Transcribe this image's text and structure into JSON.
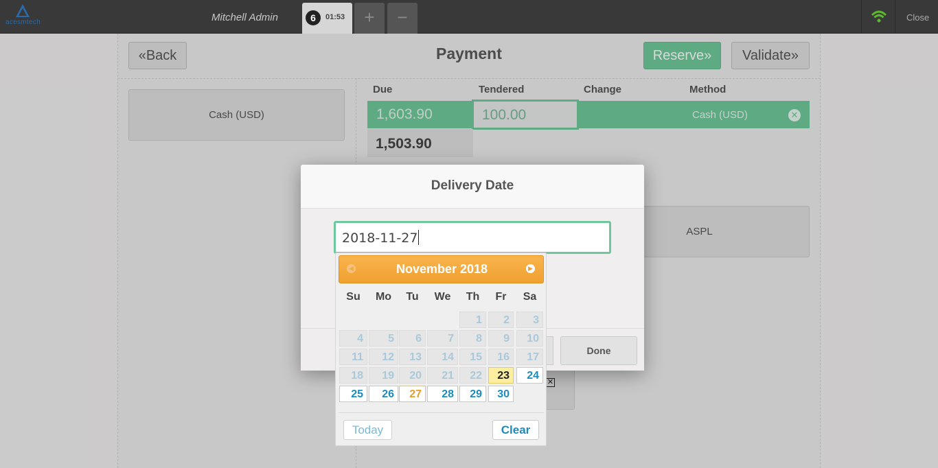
{
  "topbar": {
    "logo_text": "acesmtech",
    "user_name": "Mitchell Admin",
    "order_number": "6",
    "order_time": "01:53",
    "add_order": "+",
    "remove_order": "−",
    "close_label": "Close"
  },
  "payment": {
    "title": "Payment",
    "back_label": "Back",
    "reserve_label": "Reserve",
    "validate_label": "Validate",
    "payment_method": "Cash (USD)",
    "columns": {
      "due": "Due",
      "tendered": "Tendered",
      "change": "Change",
      "method": "Method"
    },
    "line": {
      "due": "1,603.90",
      "tendered": "100.00",
      "method": "Cash (USD)"
    },
    "remaining": "1,503.90",
    "customer": "ASPL"
  },
  "modal": {
    "title": "Delivery Date",
    "input_value": "2018-11-27",
    "done_label": "Done"
  },
  "datepicker": {
    "month_title": "November 2018",
    "weekdays": [
      "Su",
      "Mo",
      "Tu",
      "We",
      "Th",
      "Fr",
      "Sa"
    ],
    "days": [
      [
        "",
        "",
        "",
        "",
        "1",
        "2",
        "3"
      ],
      [
        "4",
        "5",
        "6",
        "7",
        "8",
        "9",
        "10"
      ],
      [
        "11",
        "12",
        "13",
        "14",
        "15",
        "16",
        "17"
      ],
      [
        "18",
        "19",
        "20",
        "21",
        "22",
        "23",
        "24"
      ],
      [
        "25",
        "26",
        "27",
        "28",
        "29",
        "30",
        ""
      ]
    ],
    "today_day": "23",
    "selected_day": "27",
    "today_label": "Today",
    "clear_label": "Clear"
  },
  "colors": {
    "accent_green": "#6ec89b",
    "datepicker_orange": "#f0a030",
    "link_blue": "#1a8cbf"
  }
}
